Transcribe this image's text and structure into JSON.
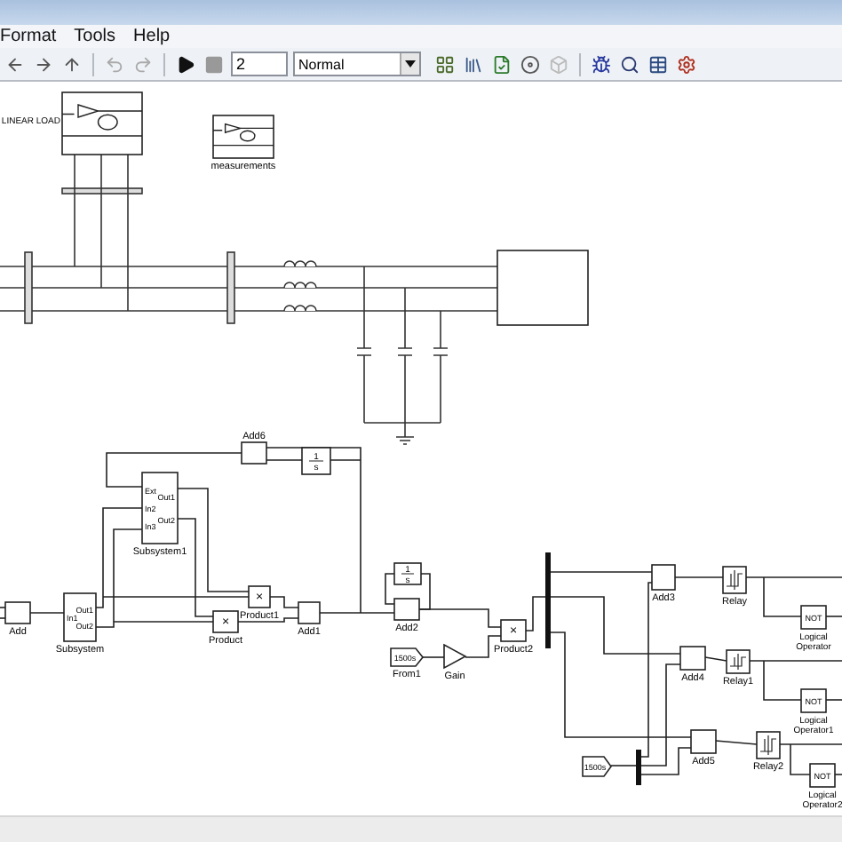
{
  "menu": [
    {
      "label": "Format"
    },
    {
      "label": "Tools"
    },
    {
      "label": "Help"
    }
  ],
  "toolbar": {
    "stop_time": "2",
    "sim_mode": "Normal"
  },
  "blocks": [
    {
      "kind": "power",
      "label": "LINEAR LOAD"
    },
    {
      "kind": "power",
      "label": "measurements"
    },
    {
      "kind": "box"
    },
    {
      "kind": "sum",
      "label": "Add6"
    },
    {
      "kind": "integrator",
      "numerator": "1",
      "denominator": "s"
    },
    {
      "kind": "subsystem",
      "label": "Subsystem1",
      "inputs": [
        "Ext",
        "In2",
        "In3"
      ],
      "outputs": [
        "Out1",
        "Out2"
      ]
    },
    {
      "kind": "sum",
      "label": "Add"
    },
    {
      "kind": "subsystem",
      "label": "Subsystem",
      "inputs": [
        "In1"
      ],
      "outputs": [
        "Out1",
        "Out2"
      ]
    },
    {
      "kind": "product",
      "label": "Product1",
      "text": "×"
    },
    {
      "kind": "product",
      "label": "Product",
      "text": "×"
    },
    {
      "kind": "sum",
      "label": "Add1"
    },
    {
      "kind": "integrator",
      "numerator": "1",
      "denominator": "s"
    },
    {
      "kind": "sum",
      "label": "Add2"
    },
    {
      "kind": "from",
      "label": "From1",
      "text": "1500s"
    },
    {
      "kind": "gain",
      "label": "Gain"
    },
    {
      "kind": "product",
      "label": "Product2",
      "text": "×"
    },
    {
      "kind": "mux"
    },
    {
      "kind": "sum",
      "label": "Add3"
    },
    {
      "kind": "relay",
      "label": "Relay"
    },
    {
      "kind": "not",
      "label": "Logical Operator",
      "text": "NOT"
    },
    {
      "kind": "sum",
      "label": "Add4"
    },
    {
      "kind": "relay",
      "label": "Relay1"
    },
    {
      "kind": "not",
      "label": "Logical Operator1",
      "text": "NOT"
    },
    {
      "kind": "from",
      "text": "1500s"
    },
    {
      "kind": "mux"
    },
    {
      "kind": "sum",
      "label": "Add5"
    },
    {
      "kind": "relay",
      "label": "Relay2"
    },
    {
      "kind": "not",
      "label": "Logical Operator2",
      "text": "NOT"
    }
  ]
}
